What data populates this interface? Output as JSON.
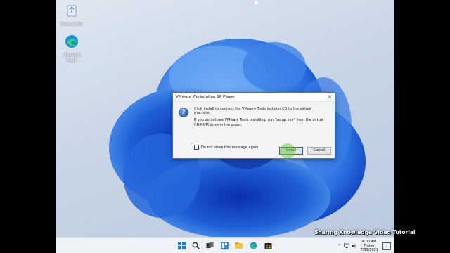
{
  "desktop": {
    "icons": [
      {
        "label": "Recycle Bin",
        "icon": "recycle-bin-icon"
      },
      {
        "label": "Microsoft Edge",
        "icon": "edge-icon"
      }
    ]
  },
  "dialog": {
    "title": "VMware Workstation 16 Player",
    "message_1": "Click Install to connect the VMware Tools installer CD to the virtual machine.",
    "message_2": "If you do not see VMware Tools installing, run \"setup.exe\" from the virtual CD-ROM drive in the guest.",
    "checkbox_label": "Do not show this message again",
    "checkbox_checked": false,
    "install_label": "Install",
    "cancel_label": "Cancel",
    "icon": "question-icon",
    "close_symbol": "✕"
  },
  "taskbar": {
    "icons": [
      "start-icon",
      "search-icon",
      "task-view-icon",
      "widgets-icon",
      "file-explorer-icon",
      "edge-icon",
      "store-icon"
    ],
    "tray_chevron": "^",
    "clock_time": "4:00 AM",
    "clock_day": "Friday",
    "clock_date": "7/30/2021",
    "notification_count": "1"
  },
  "watermark": "Sharing Knowledge Video Tutorial",
  "colors": {
    "accent": "#1a66c9",
    "wallpaper_bloom": "#1f5fd6",
    "wallpaper_bg": "#c8d5e6"
  }
}
